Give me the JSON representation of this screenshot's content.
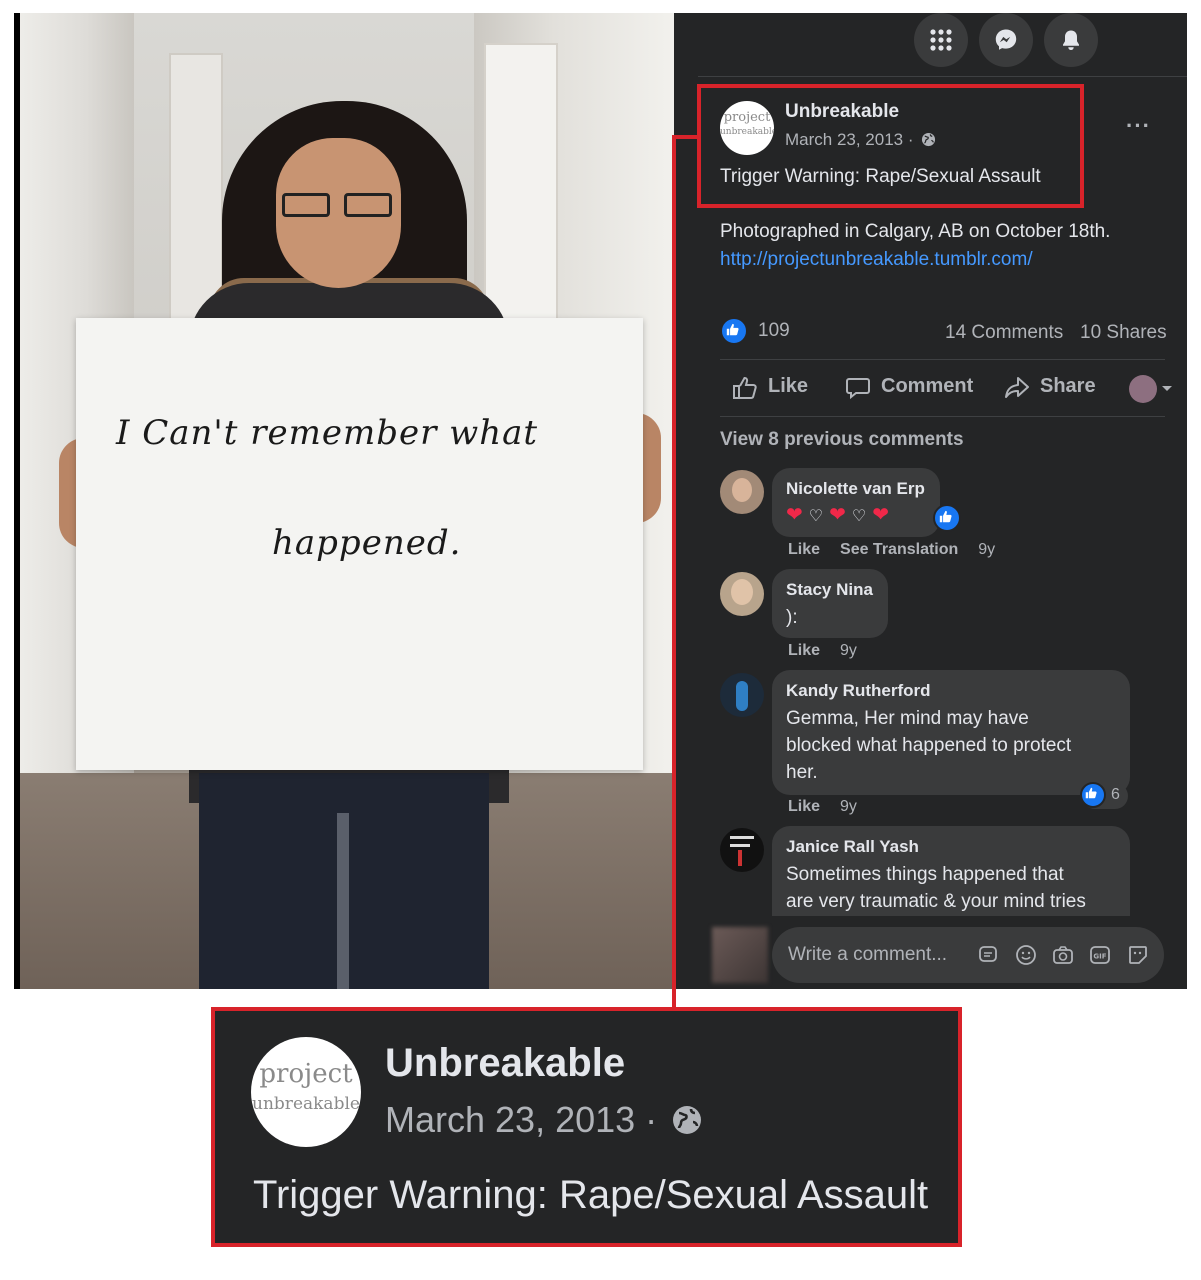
{
  "post": {
    "page_name": "Unbreakable",
    "date": "March 23, 2013 ·",
    "privacy_icon": "globe-icon",
    "avatar_line1": "project",
    "avatar_line2": "unbreakable",
    "headline": "Trigger Warning: Rape/Sexual Assault",
    "body_text": "Photographed in Calgary, AB on October 18th.",
    "link_text": "http://projectunbreakable.tumblr.com/",
    "more_label": "···"
  },
  "sign": {
    "line1": "I  Can't  remember  what",
    "line2": "happened."
  },
  "stats": {
    "reactions": "109",
    "comments": "14 Comments",
    "shares": "10 Shares"
  },
  "actions": {
    "like": "Like",
    "comment": "Comment",
    "share": "Share"
  },
  "view_previous": "View 8 previous comments",
  "comments": [
    {
      "author": "Nicolette van Erp",
      "text": "",
      "actions": [
        "Like",
        "See Translation",
        "9y"
      ]
    },
    {
      "author": "Stacy Nina",
      "text": "):",
      "actions": [
        "Like",
        "9y"
      ]
    },
    {
      "author": "Kandy Rutherford",
      "lines": [
        "Gemma, Her mind may have",
        "blocked what happened to protect",
        "her."
      ],
      "reaction_count": "6",
      "actions": [
        "Like",
        "9y"
      ]
    },
    {
      "author": "Janice Rall Yash",
      "lines": [
        "Sometimes things happened that",
        "are very traumatic & your mind tries"
      ]
    }
  ],
  "composer": {
    "placeholder": "Write a comment..."
  },
  "colors": {
    "panel_bg": "#242526",
    "bubble_bg": "#3a3b3c",
    "highlight_red": "#d8232a",
    "link_blue": "#4599ff",
    "like_blue": "#1877f2"
  }
}
